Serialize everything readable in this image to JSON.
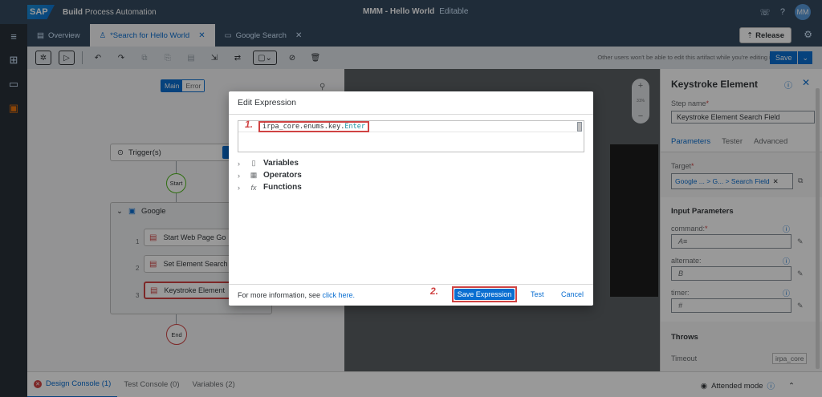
{
  "shell": {
    "logo": "SAP",
    "product_bold": "Build",
    "product_rest": "Process Automation",
    "project": "MMM - Hello World",
    "mode": "Editable",
    "avatar": "MM",
    "icons": [
      "notification-icon",
      "help-icon"
    ]
  },
  "tabs": [
    {
      "label": "Overview",
      "icon": "document-icon"
    },
    {
      "label": "*Search for Hello World",
      "icon": "automation-icon",
      "close": "✕"
    },
    {
      "label": "Google Search",
      "icon": "window-icon",
      "close": "✕"
    }
  ],
  "release_label": "Release",
  "toolbar": {
    "warning": "Other users won't be able to edit this artifact while you're editing it.",
    "save_label": "Save"
  },
  "canvas": {
    "main_tab": "Main",
    "error_tab": "Error",
    "trigger_label": "Trigger(s)",
    "start_label": "Start",
    "end_label": "End",
    "group_label": "Google",
    "steps": [
      {
        "num": "1",
        "label": "Start Web Page Go"
      },
      {
        "num": "2",
        "label": "Set Element Search"
      },
      {
        "num": "3",
        "label": "Keystroke Element"
      }
    ],
    "zoom_pct": "31%"
  },
  "panel": {
    "title": "Keystroke Element",
    "step_name_label": "Step name",
    "step_name_value": "Keystroke Element Search Field",
    "tabs": [
      "Parameters",
      "Tester",
      "Advanced"
    ],
    "target_label": "Target",
    "target_value": "Google ... > G... > Search Field",
    "input_params_title": "Input Parameters",
    "params": [
      {
        "label": "command:",
        "required": true,
        "value": "A≡"
      },
      {
        "label": "alternate:",
        "required": false,
        "value": "B"
      },
      {
        "label": "timer:",
        "required": false,
        "value": "#"
      }
    ],
    "throws_title": "Throws",
    "timeout_label": "Timeout",
    "timeout_value": "irpa_core"
  },
  "bottom": {
    "tabs": [
      "Design Console (1)",
      "Test Console (0)",
      "Variables (2)"
    ],
    "attended": "Attended mode"
  },
  "dialog": {
    "title": "Edit Expression",
    "code_prefix": "irpa_core.enums.key.",
    "code_keyword": "Enter",
    "mark1": "1.",
    "mark2": "2.",
    "tree": [
      {
        "label": "Variables",
        "icon": "variable-icon"
      },
      {
        "label": "Operators",
        "icon": "calculator-icon"
      },
      {
        "label": "Functions",
        "icon": "function-icon"
      }
    ],
    "footer_text": "For more information, see ",
    "footer_link": "click here.",
    "save_expression": "Save Expression",
    "test": "Test",
    "cancel": "Cancel"
  },
  "colors": {
    "shell": "#354a5f",
    "accent": "#0a6ed1",
    "highlight": "#d04343"
  }
}
